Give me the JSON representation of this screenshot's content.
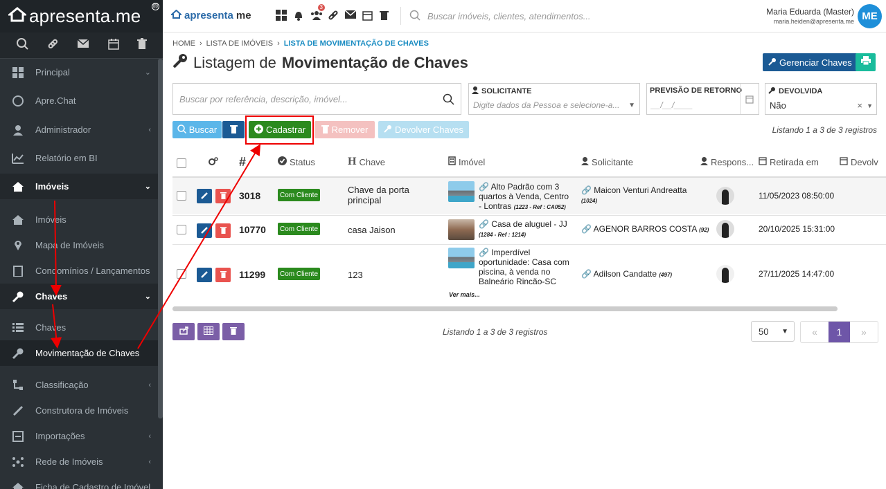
{
  "app": {
    "logo": "apresenta.me",
    "brand_prefix": "apresenta",
    "brand_suffix": "me"
  },
  "sidebar": {
    "items": [
      {
        "label": "Principal"
      },
      {
        "label": "Apre.Chat"
      },
      {
        "label": "Administrador"
      },
      {
        "label": "Relatório em BI"
      },
      {
        "label": "Imóveis"
      },
      {
        "label": "Imóveis"
      },
      {
        "label": "Mapa de Imóveis"
      },
      {
        "label": "Condomínios / Lançamentos"
      },
      {
        "label": "Chaves"
      },
      {
        "label": "Chaves"
      },
      {
        "label": "Movimentação de Chaves"
      },
      {
        "label": "Classificação"
      },
      {
        "label": "Construtora de Imóveis"
      },
      {
        "label": "Importações"
      },
      {
        "label": "Rede de Imóveis"
      },
      {
        "label": "Ficha de Cadastro de Imóvel"
      }
    ]
  },
  "topbar": {
    "search_placeholder": "Buscar imóveis, clientes, atendimentos...",
    "notif_count": "3",
    "user_name": "Maria Eduarda (Master)",
    "user_email": "maria.heiden@apresenta.me",
    "avatar_initials": "ME"
  },
  "breadcrumb": {
    "home": "HOME",
    "list": "LISTA DE IMÓVEIS",
    "current": "LISTA DE MOVIMENTAÇÃO DE CHAVES"
  },
  "page": {
    "title_prefix": "Listagem de",
    "title_main": "Movimentação de Chaves",
    "manage_button": "Gerenciar Chaves"
  },
  "filters": {
    "search_placeholder": "Buscar por referência, descrição, imóvel...",
    "solicitante_label": "SOLICITANTE",
    "solicitante_placeholder": "Digite dados da Pessoa e selecione-a...",
    "previsao_label": "PREVISÃO DE RETORNO",
    "previsao_placeholder": "__/__/____",
    "devolvida_label": "DEVOLVIDA",
    "devolvida_value": "Não"
  },
  "actions": {
    "buscar": "Buscar",
    "cadastrar": "Cadastrar",
    "remover": "Remover",
    "devolver": "Devolver Chaves"
  },
  "count_text": "Listando 1 a 3 de 3 registros",
  "table": {
    "headers": {
      "code": "#",
      "status": "Status",
      "chave": "Chave",
      "imovel": "Imóvel",
      "solicitante": "Solicitante",
      "responsavel": "Respons...",
      "retirada": "Retirada em",
      "devolvida": "Devolv"
    },
    "rows": [
      {
        "code": "3018",
        "status": "Com Cliente",
        "chave": "Chave da porta principal",
        "imovel": "Alto Padrão com 3 quartos à Venda, Centro - Lontras",
        "imovel_ref": "(1223 - Ref : CA052)",
        "solicitante": "Maicon Venturi Andreatta",
        "sol_ref": "(1024)",
        "retirada": "11/05/2023 08:50:00"
      },
      {
        "code": "10770",
        "status": "Com Cliente",
        "chave": "casa Jaison",
        "imovel": "Casa de aluguel - JJ",
        "imovel_ref": "(1284 - Ref : 1214)",
        "solicitante": "AGENOR BARROS COSTA",
        "sol_ref": "(92)",
        "retirada": "20/10/2025 15:31:00"
      },
      {
        "code": "11299",
        "status": "Com Cliente",
        "chave": "123",
        "imovel": "Imperdível oportunidade: Casa com piscina, à venda no Balneário Rincão-SC",
        "imovel_more": "Ver mais...",
        "solicitante": "Adilson Candatte",
        "sol_ref": "(497)",
        "retirada": "27/11/2025 14:47:00"
      }
    ]
  },
  "pagination": {
    "per_page": "50",
    "current_page": "1"
  },
  "colors": {
    "primary": "#1b5a94",
    "success": "#2b8a1e",
    "danger": "#e9534f",
    "sidebar": "#2b3136",
    "highlight": "#e00000"
  }
}
